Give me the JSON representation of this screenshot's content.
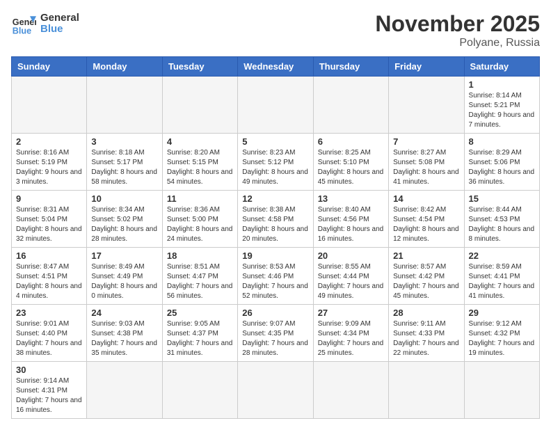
{
  "header": {
    "logo_general": "General",
    "logo_blue": "Blue",
    "month": "November 2025",
    "location": "Polyane, Russia"
  },
  "weekdays": [
    "Sunday",
    "Monday",
    "Tuesday",
    "Wednesday",
    "Thursday",
    "Friday",
    "Saturday"
  ],
  "weeks": [
    [
      {
        "day": "",
        "info": ""
      },
      {
        "day": "",
        "info": ""
      },
      {
        "day": "",
        "info": ""
      },
      {
        "day": "",
        "info": ""
      },
      {
        "day": "",
        "info": ""
      },
      {
        "day": "",
        "info": ""
      },
      {
        "day": "1",
        "info": "Sunrise: 8:14 AM\nSunset: 5:21 PM\nDaylight: 9 hours and 7 minutes."
      }
    ],
    [
      {
        "day": "2",
        "info": "Sunrise: 8:16 AM\nSunset: 5:19 PM\nDaylight: 9 hours and 3 minutes."
      },
      {
        "day": "3",
        "info": "Sunrise: 8:18 AM\nSunset: 5:17 PM\nDaylight: 8 hours and 58 minutes."
      },
      {
        "day": "4",
        "info": "Sunrise: 8:20 AM\nSunset: 5:15 PM\nDaylight: 8 hours and 54 minutes."
      },
      {
        "day": "5",
        "info": "Sunrise: 8:23 AM\nSunset: 5:12 PM\nDaylight: 8 hours and 49 minutes."
      },
      {
        "day": "6",
        "info": "Sunrise: 8:25 AM\nSunset: 5:10 PM\nDaylight: 8 hours and 45 minutes."
      },
      {
        "day": "7",
        "info": "Sunrise: 8:27 AM\nSunset: 5:08 PM\nDaylight: 8 hours and 41 minutes."
      },
      {
        "day": "8",
        "info": "Sunrise: 8:29 AM\nSunset: 5:06 PM\nDaylight: 8 hours and 36 minutes."
      }
    ],
    [
      {
        "day": "9",
        "info": "Sunrise: 8:31 AM\nSunset: 5:04 PM\nDaylight: 8 hours and 32 minutes."
      },
      {
        "day": "10",
        "info": "Sunrise: 8:34 AM\nSunset: 5:02 PM\nDaylight: 8 hours and 28 minutes."
      },
      {
        "day": "11",
        "info": "Sunrise: 8:36 AM\nSunset: 5:00 PM\nDaylight: 8 hours and 24 minutes."
      },
      {
        "day": "12",
        "info": "Sunrise: 8:38 AM\nSunset: 4:58 PM\nDaylight: 8 hours and 20 minutes."
      },
      {
        "day": "13",
        "info": "Sunrise: 8:40 AM\nSunset: 4:56 PM\nDaylight: 8 hours and 16 minutes."
      },
      {
        "day": "14",
        "info": "Sunrise: 8:42 AM\nSunset: 4:54 PM\nDaylight: 8 hours and 12 minutes."
      },
      {
        "day": "15",
        "info": "Sunrise: 8:44 AM\nSunset: 4:53 PM\nDaylight: 8 hours and 8 minutes."
      }
    ],
    [
      {
        "day": "16",
        "info": "Sunrise: 8:47 AM\nSunset: 4:51 PM\nDaylight: 8 hours and 4 minutes."
      },
      {
        "day": "17",
        "info": "Sunrise: 8:49 AM\nSunset: 4:49 PM\nDaylight: 8 hours and 0 minutes."
      },
      {
        "day": "18",
        "info": "Sunrise: 8:51 AM\nSunset: 4:47 PM\nDaylight: 7 hours and 56 minutes."
      },
      {
        "day": "19",
        "info": "Sunrise: 8:53 AM\nSunset: 4:46 PM\nDaylight: 7 hours and 52 minutes."
      },
      {
        "day": "20",
        "info": "Sunrise: 8:55 AM\nSunset: 4:44 PM\nDaylight: 7 hours and 49 minutes."
      },
      {
        "day": "21",
        "info": "Sunrise: 8:57 AM\nSunset: 4:42 PM\nDaylight: 7 hours and 45 minutes."
      },
      {
        "day": "22",
        "info": "Sunrise: 8:59 AM\nSunset: 4:41 PM\nDaylight: 7 hours and 41 minutes."
      }
    ],
    [
      {
        "day": "23",
        "info": "Sunrise: 9:01 AM\nSunset: 4:40 PM\nDaylight: 7 hours and 38 minutes."
      },
      {
        "day": "24",
        "info": "Sunrise: 9:03 AM\nSunset: 4:38 PM\nDaylight: 7 hours and 35 minutes."
      },
      {
        "day": "25",
        "info": "Sunrise: 9:05 AM\nSunset: 4:37 PM\nDaylight: 7 hours and 31 minutes."
      },
      {
        "day": "26",
        "info": "Sunrise: 9:07 AM\nSunset: 4:35 PM\nDaylight: 7 hours and 28 minutes."
      },
      {
        "day": "27",
        "info": "Sunrise: 9:09 AM\nSunset: 4:34 PM\nDaylight: 7 hours and 25 minutes."
      },
      {
        "day": "28",
        "info": "Sunrise: 9:11 AM\nSunset: 4:33 PM\nDaylight: 7 hours and 22 minutes."
      },
      {
        "day": "29",
        "info": "Sunrise: 9:12 AM\nSunset: 4:32 PM\nDaylight: 7 hours and 19 minutes."
      }
    ],
    [
      {
        "day": "30",
        "info": "Sunrise: 9:14 AM\nSunset: 4:31 PM\nDaylight: 7 hours and 16 minutes."
      },
      {
        "day": "",
        "info": ""
      },
      {
        "day": "",
        "info": ""
      },
      {
        "day": "",
        "info": ""
      },
      {
        "day": "",
        "info": ""
      },
      {
        "day": "",
        "info": ""
      },
      {
        "day": "",
        "info": ""
      }
    ]
  ]
}
